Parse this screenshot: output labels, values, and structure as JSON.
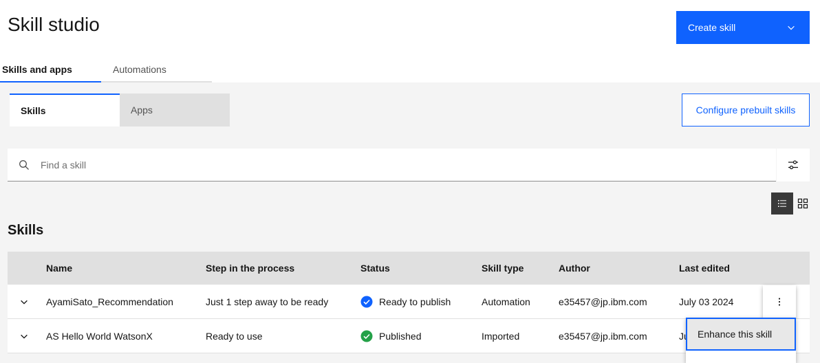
{
  "page": {
    "title": "Skill studio"
  },
  "header": {
    "create_button_label": "Create skill"
  },
  "tabs": [
    {
      "label": "Skills and apps",
      "active": true
    },
    {
      "label": "Automations",
      "active": false
    }
  ],
  "segmented": [
    {
      "label": "Skills",
      "active": true
    },
    {
      "label": "Apps",
      "active": false
    }
  ],
  "configure_button_label": "Configure prebuilt skills",
  "search": {
    "placeholder": "Find a skill",
    "value": ""
  },
  "section_title": "Skills",
  "table": {
    "columns": [
      "Name",
      "Step in the process",
      "Status",
      "Skill type",
      "Author",
      "Last edited"
    ],
    "rows": [
      {
        "name": "AyamiSato_Recommendation",
        "step": "Just 1 step away to be ready",
        "status": "Ready to publish",
        "status_icon": "checkmark-filled-blue-icon",
        "type": "Automation",
        "author": "e35457@jp.ibm.com",
        "edited": "July 03 2024"
      },
      {
        "name": "AS Hello World WatsonX",
        "step": "Ready to use",
        "status": "Published",
        "status_icon": "checkmark-filled-green-icon",
        "type": "Imported",
        "author": "e35457@jp.ibm.com",
        "edited": "Ju"
      }
    ]
  },
  "overflow_menu": {
    "items": [
      "Enhance this skill"
    ]
  },
  "colors": {
    "accent": "#0f62fe",
    "status_blue": "#0f62fe",
    "status_green": "#24a148",
    "background": "#f4f4f4"
  }
}
